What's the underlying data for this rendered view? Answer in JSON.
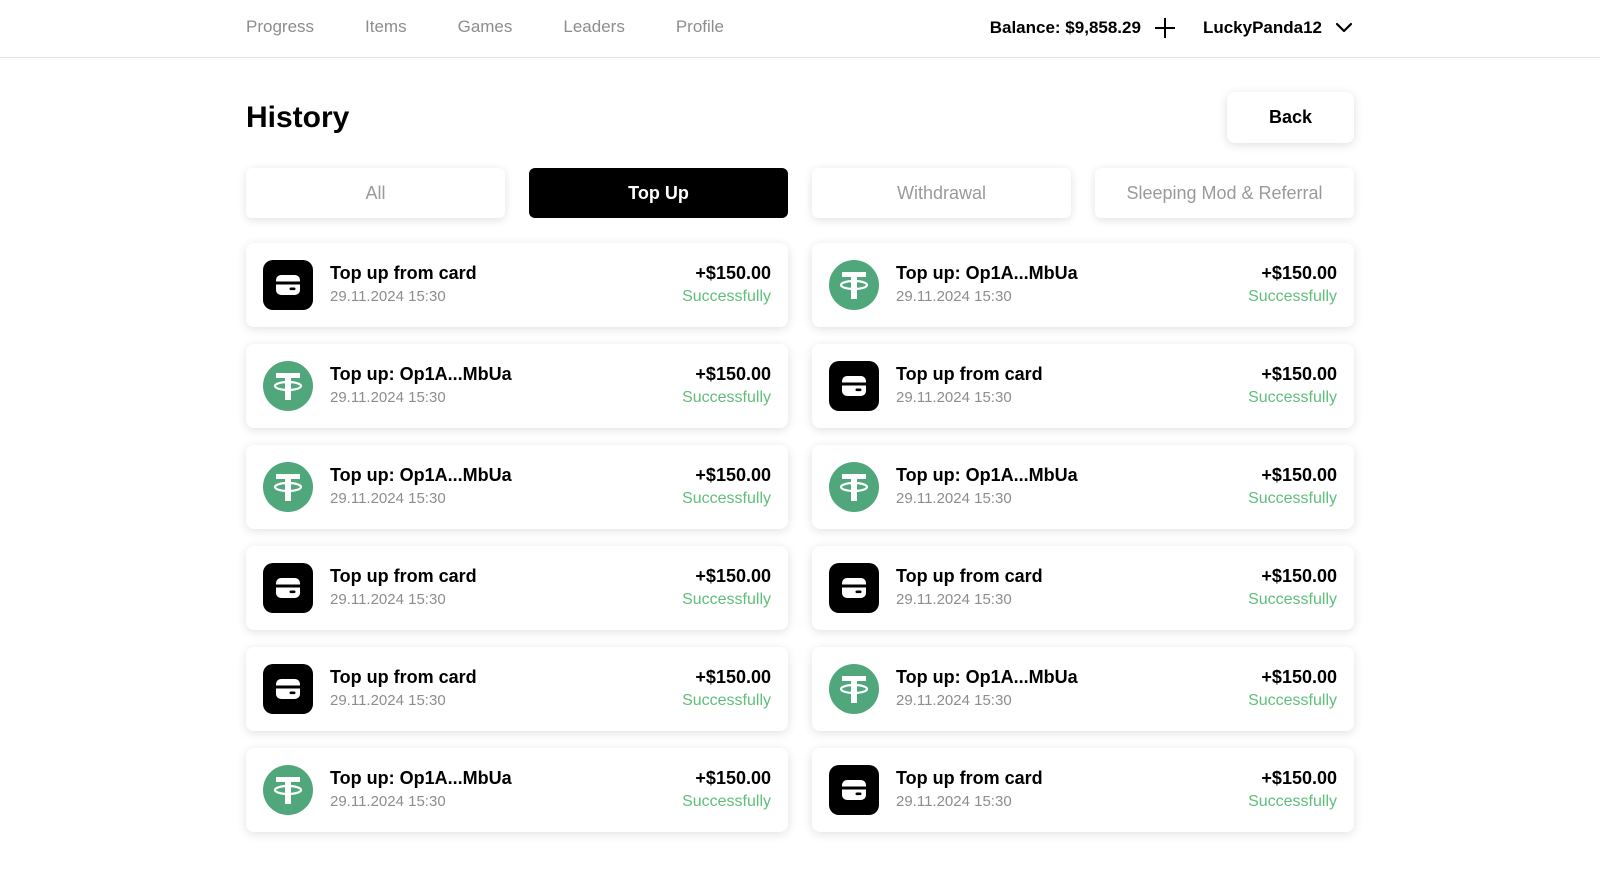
{
  "nav": {
    "items": [
      "Progress",
      "Items",
      "Games",
      "Leaders",
      "Profile"
    ],
    "balance": "Balance: $9,858.29",
    "username": "LuckyPanda12"
  },
  "page": {
    "title": "History",
    "back_label": "Back"
  },
  "tabs": [
    {
      "label": "All",
      "active": false
    },
    {
      "label": "Top Up",
      "active": true
    },
    {
      "label": "Withdrawal",
      "active": false
    },
    {
      "label": "Sleeping Mod & Referral",
      "active": false
    }
  ],
  "colors": {
    "success": "#5fbf7a",
    "tether": "#50a77c",
    "card_icon_bg": "#000000"
  },
  "transactions": [
    {
      "icon": "card-icon",
      "title": "Top up from card",
      "date": "29.11.2024 15:30",
      "amount": "+$150.00",
      "status": "Successfully"
    },
    {
      "icon": "tether-icon",
      "title": "Top up: Op1A...MbUa",
      "date": "29.11.2024 15:30",
      "amount": "+$150.00",
      "status": "Successfully"
    },
    {
      "icon": "tether-icon",
      "title": "Top up: Op1A...MbUa",
      "date": "29.11.2024 15:30",
      "amount": "+$150.00",
      "status": "Successfully"
    },
    {
      "icon": "card-icon",
      "title": "Top up from card",
      "date": "29.11.2024 15:30",
      "amount": "+$150.00",
      "status": "Successfully"
    },
    {
      "icon": "tether-icon",
      "title": "Top up: Op1A...MbUa",
      "date": "29.11.2024 15:30",
      "amount": "+$150.00",
      "status": "Successfully"
    },
    {
      "icon": "tether-icon",
      "title": "Top up: Op1A...MbUa",
      "date": "29.11.2024 15:30",
      "amount": "+$150.00",
      "status": "Successfully"
    },
    {
      "icon": "card-icon",
      "title": "Top up from card",
      "date": "29.11.2024 15:30",
      "amount": "+$150.00",
      "status": "Successfully"
    },
    {
      "icon": "card-icon",
      "title": "Top up from card",
      "date": "29.11.2024 15:30",
      "amount": "+$150.00",
      "status": "Successfully"
    },
    {
      "icon": "card-icon",
      "title": "Top up from card",
      "date": "29.11.2024 15:30",
      "amount": "+$150.00",
      "status": "Successfully"
    },
    {
      "icon": "tether-icon",
      "title": "Top up: Op1A...MbUa",
      "date": "29.11.2024 15:30",
      "amount": "+$150.00",
      "status": "Successfully"
    },
    {
      "icon": "tether-icon",
      "title": "Top up: Op1A...MbUa",
      "date": "29.11.2024 15:30",
      "amount": "+$150.00",
      "status": "Successfully"
    },
    {
      "icon": "card-icon",
      "title": "Top up from card",
      "date": "29.11.2024 15:30",
      "amount": "+$150.00",
      "status": "Successfully"
    }
  ]
}
